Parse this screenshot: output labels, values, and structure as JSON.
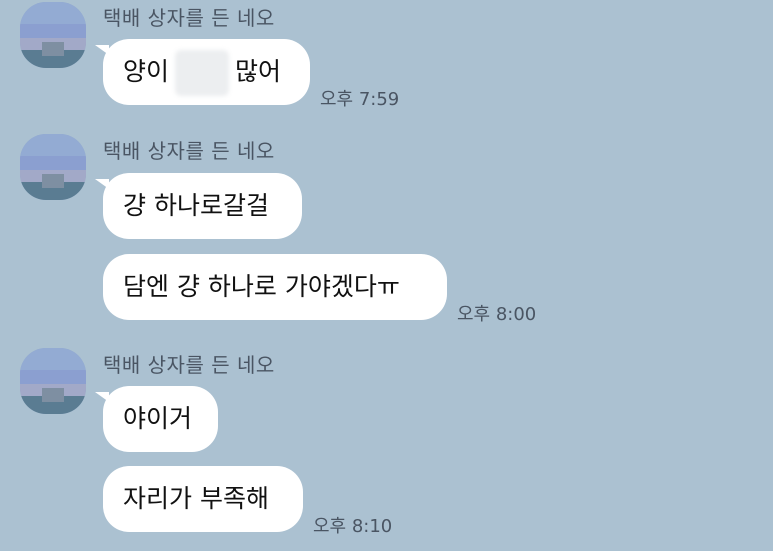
{
  "groups": [
    {
      "sender": "택배 상자를 든 네오",
      "messages": [
        {
          "text_before": "양이",
          "text_after": "많어"
        }
      ],
      "time": "오후 7:59"
    },
    {
      "sender": "택배 상자를 든 네오",
      "messages": [
        {
          "text": "걍 하나로갈걸"
        },
        {
          "text": "담엔 걍 하나로 가야겠다ㅠ"
        }
      ],
      "time": "오후 8:00"
    },
    {
      "sender": "택배 상자를 든 네오",
      "messages": [
        {
          "text": "야이거"
        },
        {
          "text": "자리가 부족해"
        }
      ],
      "time": "오후 8:10"
    }
  ]
}
